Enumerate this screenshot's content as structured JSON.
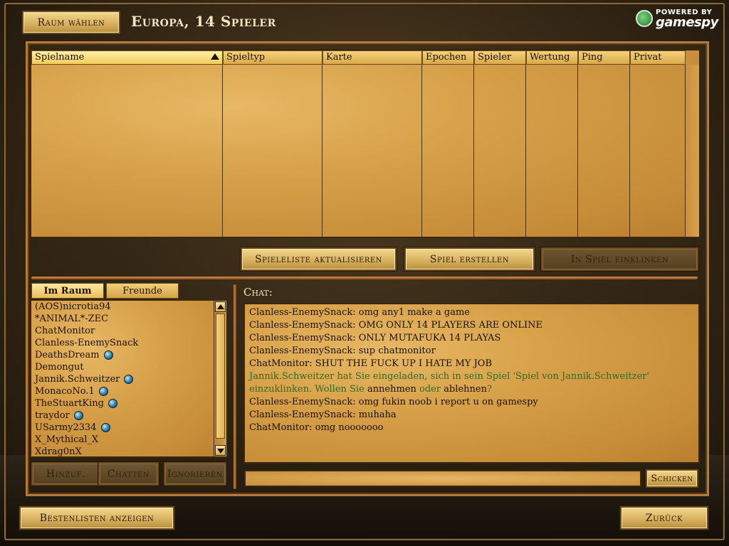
{
  "header": {
    "room_button": "Raum wählen",
    "title": "Europa, 14 Spieler",
    "logo_top": "POWERED BY",
    "logo_bottom": "gamespy"
  },
  "game_table": {
    "columns": [
      "Spielname",
      "Spieltyp",
      "Karte",
      "Epochen",
      "Spieler",
      "Wertung",
      "Ping",
      "Privat"
    ],
    "sorted_column": "Spielname",
    "rows": []
  },
  "actions": {
    "refresh": "Spieleliste aktualisieren",
    "create": "Spiel erstellen",
    "join": "In Spiel einklinken"
  },
  "tabs": {
    "in_room": "Im Raum",
    "friends": "Freunde"
  },
  "players": [
    {
      "name": "(AOS)nicrotia94",
      "globe": false
    },
    {
      "name": "*ANIMAL*-ZEC",
      "globe": false
    },
    {
      "name": "ChatMonitor",
      "globe": false
    },
    {
      "name": "Clanless-EnemySnack",
      "globe": false
    },
    {
      "name": "DeathsDream",
      "globe": true
    },
    {
      "name": "Demongut",
      "globe": false
    },
    {
      "name": "Jannik.Schweitzer",
      "globe": true
    },
    {
      "name": "MonacoNo.1",
      "globe": true
    },
    {
      "name": "TheStuartKing",
      "globe": true
    },
    {
      "name": "traydor",
      "globe": true
    },
    {
      "name": "USarmy2334",
      "globe": true
    },
    {
      "name": "X_Mythical_X",
      "globe": false
    },
    {
      "name": "Xdrag0nX",
      "globe": false
    }
  ],
  "player_buttons": {
    "add": "Hinzuf.",
    "chat": "Chatten",
    "ignore": "Ignorieren"
  },
  "chat": {
    "label": "Chat:",
    "lines": [
      {
        "text": "Clanless-EnemySnack: omg any1 make a game"
      },
      {
        "text": "Clanless-EnemySnack: OMG ONLY 14 PLAYERS ARE ONLINE"
      },
      {
        "text": "Clanless-EnemySnack: ONLY MUTAFUKA 14 PLAYAS"
      },
      {
        "text": "Clanless-EnemySnack: sup chatmonitor"
      },
      {
        "text": "ChatMonitor: SHUT THE FUCK UP I HATE MY JOB"
      },
      {
        "invite": true,
        "part1": "Jannik.Schweitzer hat Sie eingeladen, sich in sein Spiel 'Spiel von Jannik.Schweitzer' einzuklinken. Wollen Sie ",
        "accept": "annehmen",
        "or": " oder ",
        "decline": "ablehnen",
        "end": "?"
      },
      {
        "text": "Clanless-EnemySnack: omg fukin noob i report u on gamespy"
      },
      {
        "text": "Clanless-EnemySnack: muhaha"
      },
      {
        "text": "ChatMonitor: omg nooooooo"
      }
    ],
    "input_value": "",
    "send_button": "Schicken"
  },
  "footer": {
    "leaderboards": "Bestenlisten anzeigen",
    "back": "Zurück"
  },
  "colors": {
    "parchment": "#d69f47",
    "system_message": "#2f6b25",
    "frame_accent": "#b47a3c"
  }
}
